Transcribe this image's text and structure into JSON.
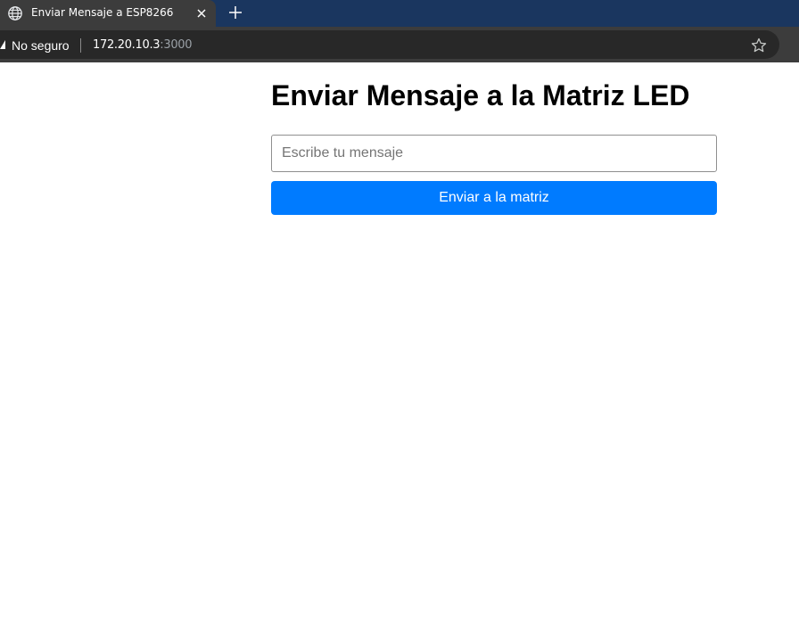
{
  "browser": {
    "tab": {
      "title": "Enviar Mensaje a ESP8266",
      "favicon": "globe-icon",
      "close_icon": "close-icon"
    },
    "new_tab_icon": "plus-icon",
    "address_bar": {
      "security_label": "No seguro",
      "security_icon": "warning-triangle-icon",
      "url_host": "172.20.10.3",
      "url_port": ":3000",
      "bookmark_icon": "star-icon"
    },
    "colors": {
      "tab_strip": "#1a365f",
      "active_tab": "#3c3c3c",
      "omnibox": "#282828"
    }
  },
  "page": {
    "heading": "Enviar Mensaje a la Matriz LED",
    "message_input": {
      "placeholder": "Escribe tu mensaje",
      "value": ""
    },
    "send_button": {
      "label": "Enviar a la matriz",
      "color": "#007bff"
    }
  }
}
